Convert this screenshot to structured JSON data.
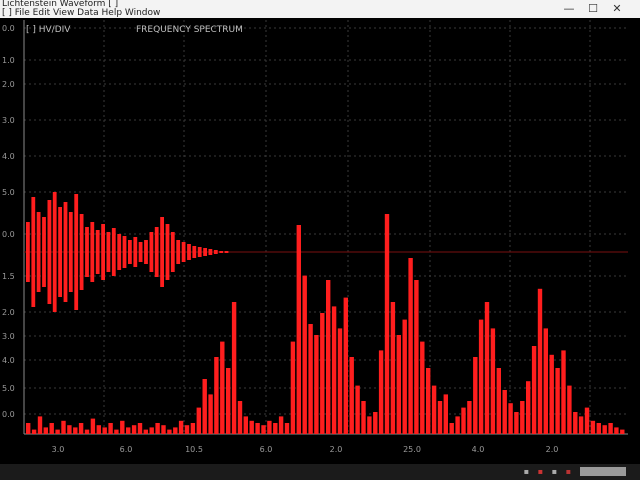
{
  "window": {
    "title": "Lichtenstein Waveform [ ]",
    "menu": "[ ] File Edit View Data Help Window",
    "minimize_symbol": "—",
    "maximize_symbol": "☐",
    "close_symbol": "✕"
  },
  "header": {
    "left_label": "[ ] HV/DIV",
    "mid_label": "FREQUENCY SPECTRUM"
  },
  "chart_data": {
    "type": "bar",
    "grid": true,
    "y_tick_labels": [
      "0.0",
      "1.0",
      "2.0",
      "3.0",
      "4.0",
      "5.0",
      "0.0",
      "1.5",
      "2.0",
      "3.0",
      "4.0",
      "5.0",
      "0.0"
    ],
    "x_tick_labels": [
      "3.0",
      "6.0",
      "10.5",
      "6.0",
      "2.0",
      "25.0",
      "4.0",
      "2.0"
    ],
    "colors": {
      "series": "#ff1e1e",
      "grid": "#3a3a3a",
      "axis": "#8a8a8a",
      "center_line": "#7a1010"
    },
    "series": [
      {
        "values": [
          0.3,
          0.55,
          0.4,
          0.35,
          0.52,
          0.6,
          0.45,
          0.5,
          0.4,
          0.58,
          0.38,
          0.25,
          0.3,
          0.22,
          0.28,
          0.2,
          0.24,
          0.18,
          0.16,
          0.12,
          0.15,
          0.1,
          0.12,
          0.2,
          0.25,
          0.35,
          0.28,
          0.2,
          0.12,
          0.1,
          0.08,
          0.06,
          0.05,
          0.04,
          0.03,
          0.02,
          0.01,
          0.01
        ]
      },
      {
        "values": [
          0.05,
          0.02,
          0.08,
          0.03,
          0.05,
          0.02,
          0.06,
          0.04,
          0.03,
          0.05,
          0.02,
          0.07,
          0.04,
          0.03,
          0.05,
          0.02,
          0.06,
          0.03,
          0.04,
          0.05,
          0.02,
          0.03,
          0.05,
          0.04,
          0.02,
          0.03,
          0.06,
          0.04,
          0.05,
          0.12,
          0.25,
          0.18,
          0.35,
          0.42,
          0.3,
          0.6,
          0.15,
          0.08,
          0.06,
          0.05,
          0.04,
          0.06,
          0.05,
          0.08,
          0.05,
          0.42,
          0.95,
          0.72,
          0.5,
          0.45,
          0.55,
          0.7,
          0.58,
          0.48,
          0.62,
          0.35,
          0.22,
          0.15,
          0.08,
          0.1,
          0.38,
          1.0,
          0.6,
          0.45,
          0.52,
          0.8,
          0.7,
          0.42,
          0.3,
          0.22,
          0.15,
          0.18,
          0.05,
          0.08,
          0.12,
          0.15,
          0.35,
          0.52,
          0.6,
          0.48,
          0.3,
          0.2,
          0.14,
          0.1,
          0.15,
          0.24,
          0.4,
          0.66,
          0.48,
          0.36,
          0.3,
          0.38,
          0.22,
          0.1,
          0.08,
          0.12,
          0.06,
          0.05,
          0.04,
          0.05,
          0.03,
          0.02
        ]
      }
    ]
  }
}
